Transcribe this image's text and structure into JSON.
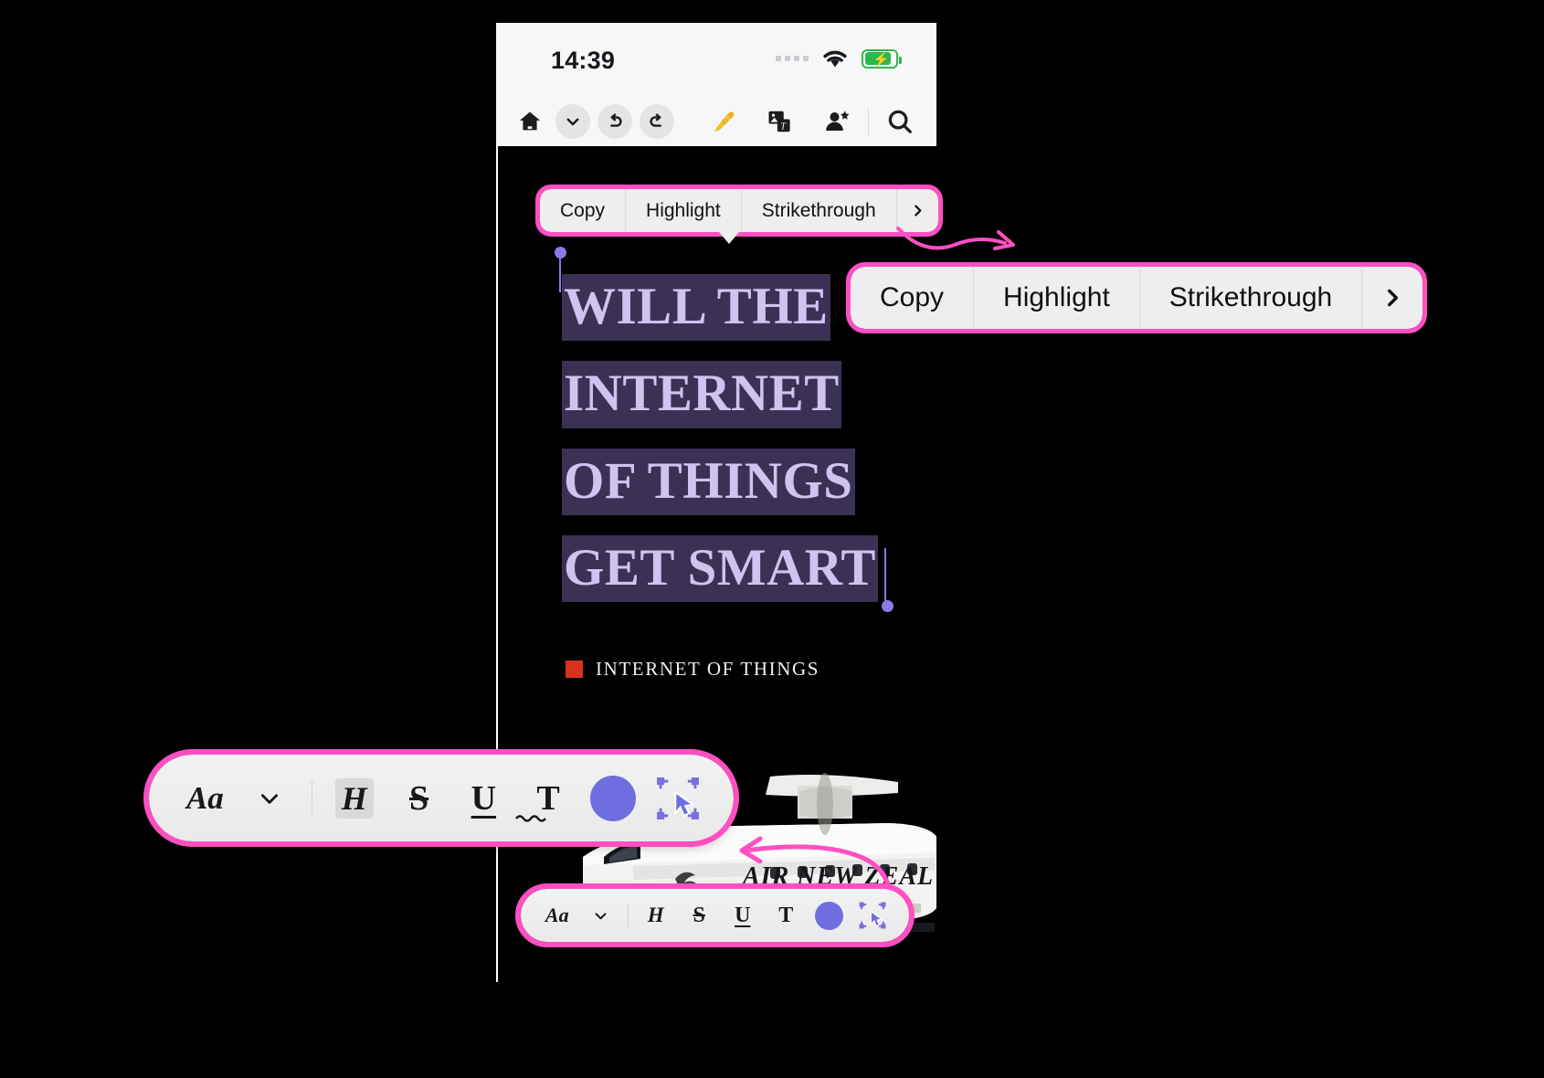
{
  "status_bar": {
    "time": "14:39",
    "signal_dots": 4,
    "wifi_icon": "wifi-icon",
    "battery_icon": "battery-charging-icon",
    "battery_color": "#2db84b"
  },
  "app_toolbar": {
    "items": [
      {
        "name": "home-icon",
        "label": "Home"
      },
      {
        "name": "chevron-down-icon",
        "label": "More"
      },
      {
        "name": "undo-icon",
        "label": "Undo"
      },
      {
        "name": "redo-icon",
        "label": "Redo"
      },
      {
        "name": "highlighter-icon",
        "label": "Highlighter"
      },
      {
        "name": "image-text-icon",
        "label": "Image to Text"
      },
      {
        "name": "person-add-icon",
        "label": "Add Person"
      },
      {
        "name": "search-icon",
        "label": "Search"
      }
    ]
  },
  "context_menu": {
    "items": [
      "Copy",
      "Highlight",
      "Strikethrough"
    ],
    "overflow_icon": "chevron-right-icon",
    "highlight_border": "#ff4fc3"
  },
  "document": {
    "headline_lines": [
      "WILL THE",
      "INTERNET",
      "OF THINGS",
      "GET SMART"
    ],
    "caption": "INTERNET OF THINGS",
    "caption_marker_color": "#d8321e",
    "selection_fill": "#3b3155",
    "selection_text_color": "#cfc3f0",
    "selection_handle_color": "#8a7ae8",
    "photo_alt_text": "AIR NEW ZEAL"
  },
  "format_toolbar": {
    "items": [
      {
        "name": "font-style-aa-icon",
        "label": "Aa"
      },
      {
        "name": "chevron-down-icon",
        "label": "v"
      },
      {
        "name": "heading-icon",
        "label": "H"
      },
      {
        "name": "strikethrough-icon",
        "label": "S"
      },
      {
        "name": "underline-icon",
        "label": "U"
      },
      {
        "name": "text-squiggle-icon",
        "label": "T"
      },
      {
        "name": "color-swatch",
        "label": ""
      },
      {
        "name": "select-region-icon",
        "label": ""
      }
    ],
    "swatch_color": "#6f6ee0",
    "highlight_border": "#ff4fc3"
  }
}
